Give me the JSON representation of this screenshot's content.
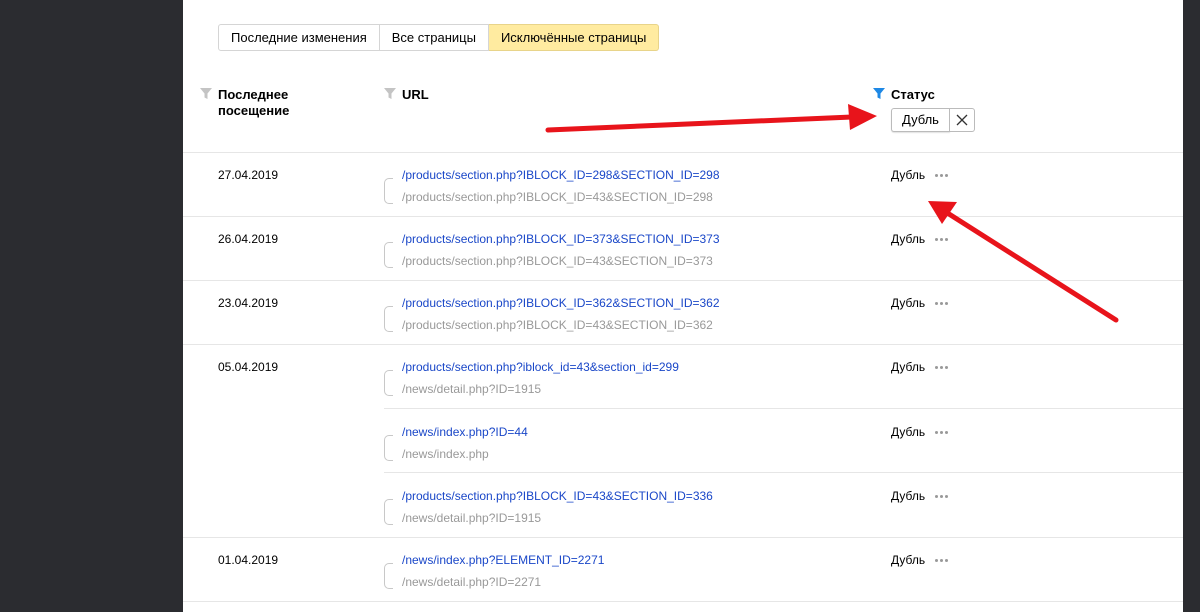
{
  "tabs": [
    {
      "label": "Последние изменения",
      "active": false
    },
    {
      "label": "Все страницы",
      "active": false
    },
    {
      "label": "Исключённые страницы",
      "active": true
    }
  ],
  "headers": {
    "last_visit": "Последнее посещение",
    "url": "URL",
    "status": "Статус"
  },
  "status_filter": {
    "value": "Дубль"
  },
  "colors": {
    "link": "#1a47c8",
    "secondary_text": "#999999",
    "active_tab": "#ffeba0",
    "filter_active": "#1e88e5",
    "arrow": "#e8141b"
  },
  "rows": [
    {
      "date": "27.04.2019",
      "url": "/products/section.php?IBLOCK_ID=298&SECTION_ID=298",
      "sub": "/products/section.php?IBLOCK_ID=43&SECTION_ID=298",
      "status": "Дубль"
    },
    {
      "date": "26.04.2019",
      "url": "/products/section.php?IBLOCK_ID=373&SECTION_ID=373",
      "sub": "/products/section.php?IBLOCK_ID=43&SECTION_ID=373",
      "status": "Дубль"
    },
    {
      "date": "23.04.2019",
      "url": "/products/section.php?IBLOCK_ID=362&SECTION_ID=362",
      "sub": "/products/section.php?IBLOCK_ID=43&SECTION_ID=362",
      "status": "Дубль"
    },
    {
      "date": "05.04.2019",
      "url": "/products/section.php?iblock_id=43&section_id=299",
      "sub": "/news/detail.php?ID=1915",
      "status": "Дубль"
    },
    {
      "date": "",
      "url": "/news/index.php?ID=44",
      "sub": "/news/index.php",
      "status": "Дубль"
    },
    {
      "date": "",
      "url": "/products/section.php?IBLOCK_ID=43&SECTION_ID=336",
      "sub": "/news/detail.php?ID=1915",
      "status": "Дубль"
    },
    {
      "date": "01.04.2019",
      "url": "/news/index.php?ELEMENT_ID=2271",
      "sub": "/news/detail.php?ID=2271",
      "status": "Дубль"
    }
  ]
}
